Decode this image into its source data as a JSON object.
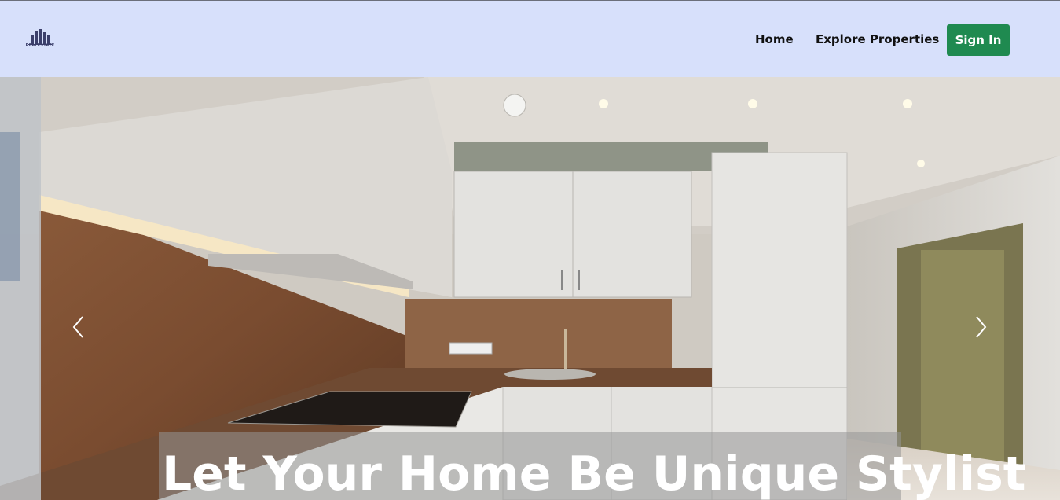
{
  "nav": {
    "logo_text": "REALESTATE",
    "links": [
      {
        "label": "Home"
      },
      {
        "label": "Explore Properties"
      }
    ],
    "signin_label": "Sign In"
  },
  "hero": {
    "caption": "Let Your Home Be Unique Stylist",
    "prev_icon": "chevron-left-icon",
    "next_icon": "chevron-right-icon"
  },
  "colors": {
    "navbar_bg": "#d7e0fb",
    "signin_bg": "#1f8a50",
    "caption_text": "#ffffff"
  }
}
